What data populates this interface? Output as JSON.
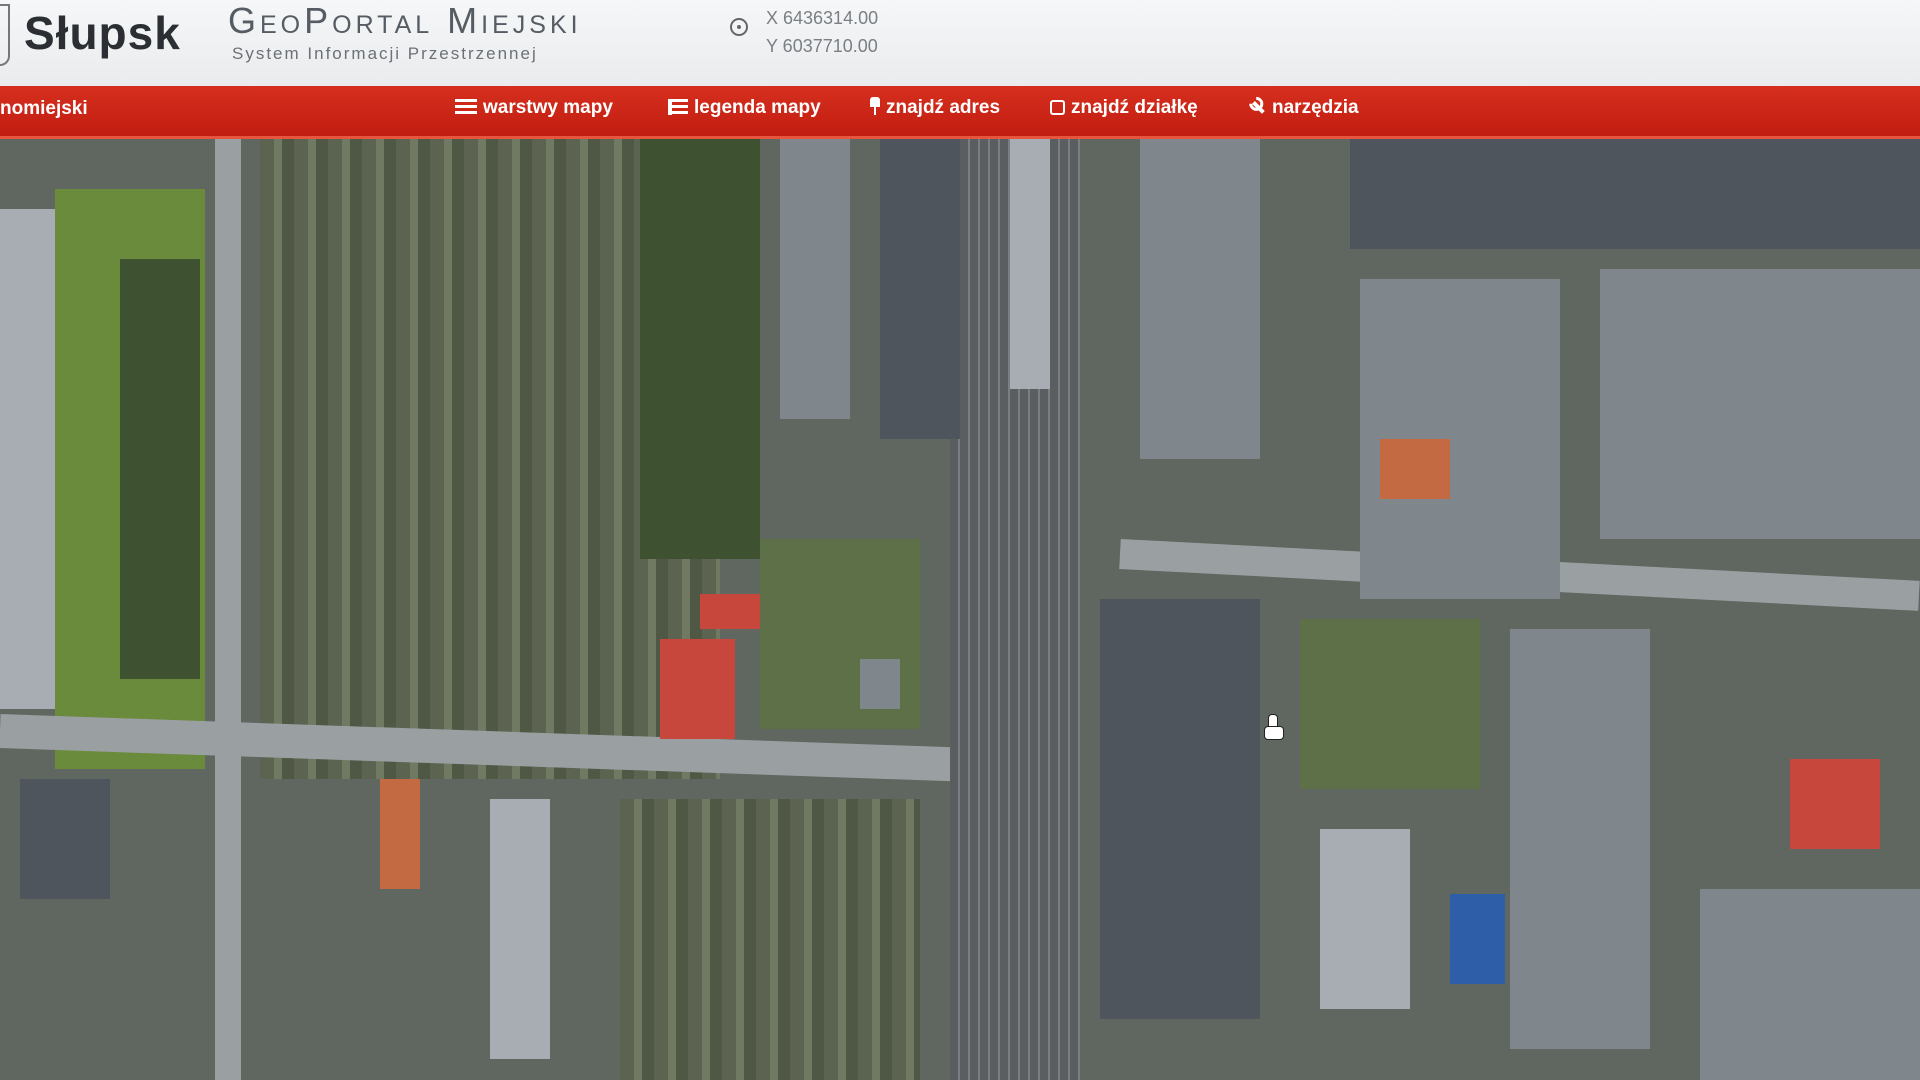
{
  "header": {
    "city_name": "Słupsk",
    "portal_title": "GeoPortal Miejski",
    "portal_subtitle": "System Informacji Przestrzennej",
    "coordinates": {
      "x_label": "X 6436314.00",
      "y_label": "Y 6037710.00"
    }
  },
  "navbar": {
    "left_partial_label": "nomiejski",
    "items": [
      {
        "label": "warstwy mapy",
        "icon": "list-icon"
      },
      {
        "label": "legenda mapy",
        "icon": "legend-icon"
      },
      {
        "label": "znajdź adres",
        "icon": "pin-icon"
      },
      {
        "label": "znajdź działkę",
        "icon": "square-icon"
      },
      {
        "label": "narzędzia",
        "icon": "wrench-icon"
      }
    ]
  },
  "colors": {
    "nav_red": "#c9241a",
    "header_bg": "#eef0f2"
  }
}
